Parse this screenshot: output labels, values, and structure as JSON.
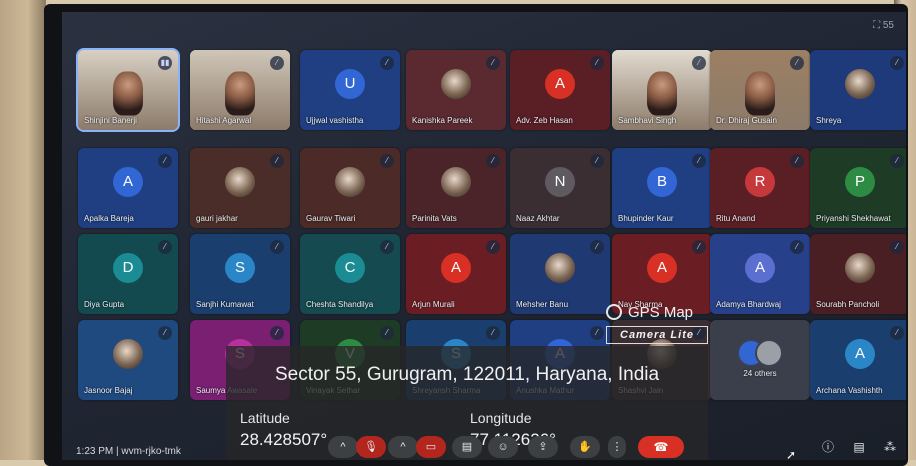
{
  "screen": {
    "top_right_text": "55"
  },
  "participants": [
    {
      "name": "Shinjini Banerji",
      "type": "video",
      "bg": "#d8d0c4",
      "mic": "on"
    },
    {
      "name": "Hitashi Agarwal",
      "type": "video",
      "bg": "#cfc6b8",
      "mic": "off"
    },
    {
      "name": "Ujjwal vashistha",
      "type": "avatar",
      "initial": "U",
      "bg": "#1f3f82",
      "avatarColor": "#3266d4",
      "mic": "off"
    },
    {
      "name": "Kanishka Pareek",
      "type": "photo",
      "bg": "#5a2a30",
      "mic": "off"
    },
    {
      "name": "Adv. Zeb Hasan",
      "type": "avatar",
      "initial": "A",
      "bg": "#5a1e25",
      "avatarColor": "#d93025",
      "mic": "off"
    },
    {
      "name": "Sambhavi Singh",
      "type": "video",
      "bg": "#e2dbd0",
      "mic": "off"
    },
    {
      "name": "Dr. Dhiraj Gusain",
      "type": "video",
      "bg": "#9c7f63",
      "mic": "off"
    },
    {
      "name": "Shreya",
      "type": "photo",
      "bg": "#1e3a7a",
      "mic": "off"
    },
    {
      "name": "Apalka Bareja",
      "type": "avatar",
      "initial": "A",
      "bg": "#1f3f82",
      "avatarColor": "#3266d4",
      "mic": "off"
    },
    {
      "name": "gauri jakhar",
      "type": "photo",
      "bg": "#4a2d28",
      "mic": "off"
    },
    {
      "name": "Gaurav Tiwari",
      "type": "photo",
      "bg": "#4b2a27",
      "mic": "off"
    },
    {
      "name": "Parinita Vats",
      "type": "photo",
      "bg": "#4a2428",
      "mic": "off"
    },
    {
      "name": "Naaz Akhtar",
      "type": "avatar",
      "initial": "N",
      "bg": "#3a2e33",
      "avatarColor": "#5f5a60",
      "mic": "off"
    },
    {
      "name": "Bhupinder Kaur",
      "type": "avatar",
      "initial": "B",
      "bg": "#1f3f82",
      "avatarColor": "#3266d4",
      "mic": "off"
    },
    {
      "name": "Ritu Anand",
      "type": "avatar",
      "initial": "R",
      "bg": "#5a1e25",
      "avatarColor": "#c5383b",
      "mic": "off"
    },
    {
      "name": "Priyanshi Shekhawat",
      "type": "avatar",
      "initial": "P",
      "bg": "#1d3b25",
      "avatarColor": "#2e8b44",
      "mic": "off"
    },
    {
      "name": "Diya Gupta",
      "type": "avatar",
      "initial": "D",
      "bg": "#134a4f",
      "avatarColor": "#1b8c93",
      "mic": "off"
    },
    {
      "name": "Sanjhi Kumawat",
      "type": "avatar",
      "initial": "S",
      "bg": "#1a3e6e",
      "avatarColor": "#2a86c6",
      "mic": "off"
    },
    {
      "name": "Cheshta Shandilya",
      "type": "avatar",
      "initial": "C",
      "bg": "#144a50",
      "avatarColor": "#1b8c93",
      "mic": "off"
    },
    {
      "name": "Arjun Murali",
      "type": "avatar",
      "initial": "A",
      "bg": "#6a1e24",
      "avatarColor": "#d93025",
      "mic": "off"
    },
    {
      "name": "Mehsher Banu",
      "type": "photo",
      "bg": "#1f3a72",
      "mic": "off"
    },
    {
      "name": "Nay Sharma",
      "type": "avatar",
      "initial": "A",
      "bg": "#6a1e24",
      "avatarColor": "#d93025",
      "mic": "off"
    },
    {
      "name": "Adamya Bhardwaj",
      "type": "avatar",
      "initial": "A",
      "bg": "#27408a",
      "avatarColor": "#5a6fd0",
      "mic": "off"
    },
    {
      "name": "Sourabh Pancholi",
      "type": "photo",
      "bg": "#4a1f24",
      "mic": "off"
    },
    {
      "name": "Jasnoor Bajaj",
      "type": "photo",
      "bg": "#1f4a80",
      "mic": "off"
    },
    {
      "name": "Saumya Awasale",
      "type": "avatar",
      "initial": "S",
      "bg": "#7a1f72",
      "avatarColor": "#b8309e",
      "mic": "off"
    },
    {
      "name": "Vinayak Sethar",
      "type": "avatar",
      "initial": "V",
      "bg": "#1d3b25",
      "avatarColor": "#2e8b44",
      "mic": "off"
    },
    {
      "name": "Shreyansh Sharma",
      "type": "avatar",
      "initial": "S",
      "bg": "#1a3e6e",
      "avatarColor": "#2a86c6",
      "mic": "off"
    },
    {
      "name": "Anushka Mathur",
      "type": "avatar",
      "initial": "A",
      "bg": "#1f3f82",
      "avatarColor": "#3266d4",
      "mic": "off"
    },
    {
      "name": "Shashvi Jain",
      "type": "photo",
      "bg": "#3a2e33",
      "mic": "off"
    },
    {
      "name": "24 others",
      "type": "others",
      "bg": "#3a3f4b",
      "mic": "none"
    },
    {
      "name": "Archana Vashishth",
      "type": "avatar",
      "initial": "A",
      "bg": "#1a3e6e",
      "avatarColor": "#2a86c6",
      "mic": "off"
    }
  ],
  "watermark": {
    "app_title": "GPS Map",
    "app_sub": "Camera Lite",
    "address": "Sector 55, Gurugram, 122011, Haryana, India",
    "latitude_label": "Latitude",
    "latitude_value": "28.428507°",
    "longitude_label": "Longitude",
    "longitude_value": "77.112626°"
  },
  "bottom": {
    "meeting_info": "1:23 PM  |  wvm-rjko-tmk",
    "controls": [
      "^",
      "mic-off",
      "^",
      "cam-off",
      "cc",
      "emoji",
      "present",
      "hand",
      "more"
    ],
    "end_call_icon": "phone-end",
    "right_icons": [
      "info-icon",
      "chat-icon",
      "activities-icon"
    ]
  }
}
